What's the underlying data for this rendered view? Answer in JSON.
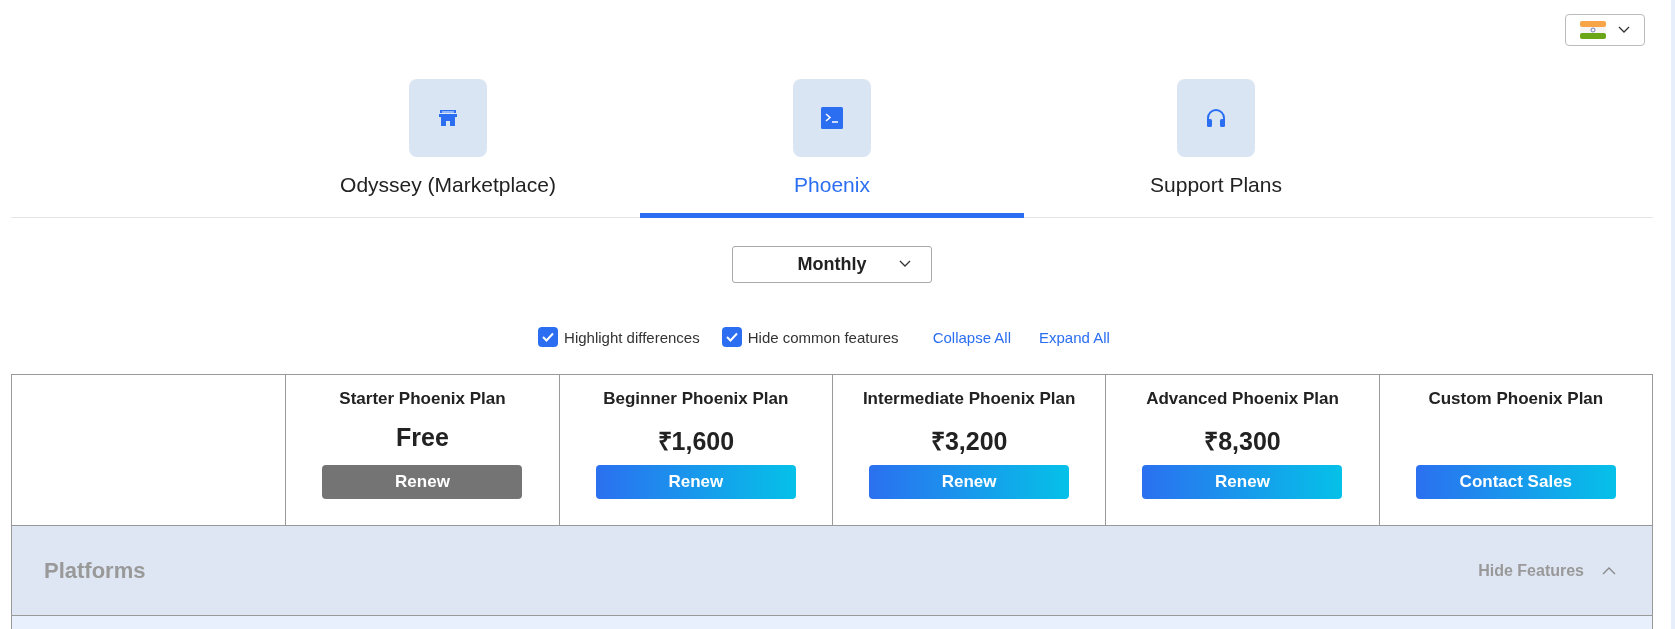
{
  "tabs": [
    {
      "label": "Odyssey (Marketplace)",
      "selected": false
    },
    {
      "label": "Phoenix",
      "selected": true
    },
    {
      "label": "Support Plans",
      "selected": false
    }
  ],
  "billing_period": {
    "value": "Monthly"
  },
  "options": [
    {
      "label": "Highlight differences",
      "checked": true
    },
    {
      "label": "Hide common features",
      "checked": true
    }
  ],
  "links": [
    "Collapse All",
    "Expand All"
  ],
  "plans": [
    {
      "name": "Starter Phoenix Plan",
      "price": "Free",
      "button": "Renew",
      "kind": "current"
    },
    {
      "name": "Beginner Phoenix Plan",
      "price": "₹1,600",
      "button": "Renew",
      "kind": "primary"
    },
    {
      "name": "Intermediate Phoenix Plan",
      "price": "₹3,200",
      "button": "Renew",
      "kind": "primary"
    },
    {
      "name": "Advanced Phoenix Plan",
      "price": "₹8,300",
      "button": "Renew",
      "kind": "primary"
    },
    {
      "name": "Custom Phoenix Plan",
      "button": "Contact Sales",
      "kind": "primary"
    }
  ],
  "section": {
    "title": "Platforms",
    "toggle": "Hide Features",
    "expanded": true
  }
}
